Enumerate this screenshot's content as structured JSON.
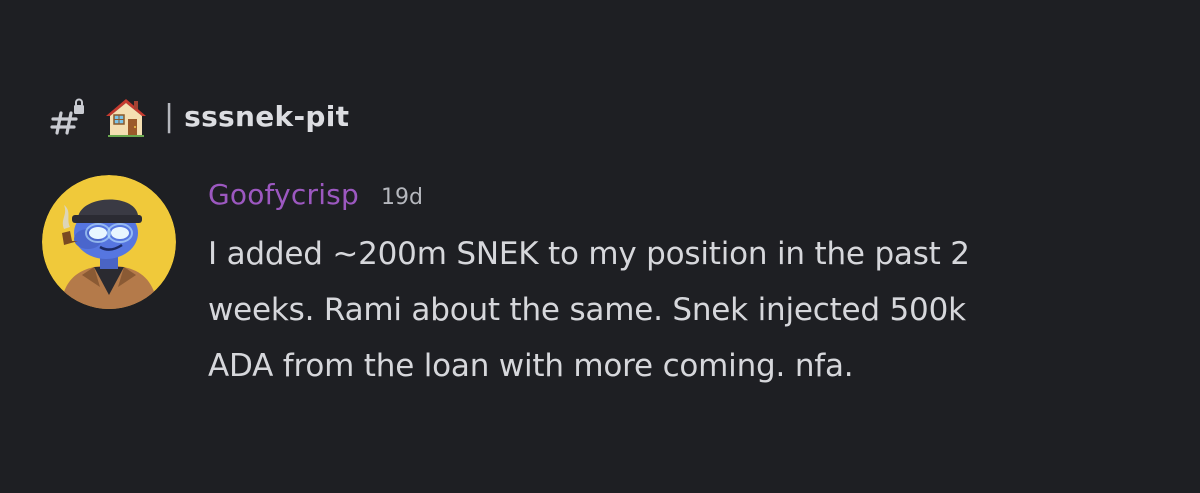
{
  "channel": {
    "separator": "|",
    "name": "sssnek-pit",
    "icons": [
      "locked-hash-icon",
      "house-emoji-icon"
    ]
  },
  "message": {
    "username": "Goofycrisp",
    "timestamp": "19d",
    "text": "I added ~200m SNEK to my position in the past 2\nweeks. Rami about the same. Snek injected 500k\nADA from the loan with more coming. nfa."
  },
  "colors": {
    "background": "#1e1f23",
    "username": "#9c58c0",
    "text": "#d6d7db",
    "avatar_ring": "#f0c93a"
  }
}
